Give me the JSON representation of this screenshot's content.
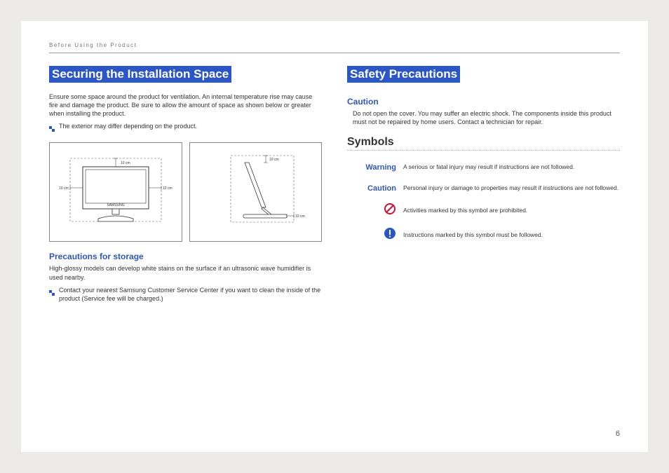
{
  "header": "Before Using the Product",
  "page_number": "6",
  "left": {
    "title": "Securing the Installation Space",
    "intro": "Ensure some space around the product for ventilation. An internal temperature rise may cause fire and damage the product. Be sure to allow the amount of space as shown below or greater when installing the product.",
    "bullet1": "The exterior may differ depending on the product.",
    "dim_top": "10 cm",
    "dim_left": "10 cm",
    "dim_right": "10 cm",
    "dim_side_top": "10 cm",
    "dim_side_bottom": "10 cm",
    "sub_heading": "Precautions for storage",
    "storage_text": "High-glossy models can develop white stains on the surface if an ultrasonic wave humidifier is used nearby.",
    "bullet2": "Contact your nearest Samsung Customer Service Center if you want to clean the inside of the product (Service fee will be charged.)"
  },
  "right": {
    "title": "Safety Precautions",
    "caution_heading": "Caution",
    "caution_text": "Do not open the cover. You may suffer an electric shock. The components inside this product must not be repaired by home users. Contact a technician for repair.",
    "symbols_heading": "Symbols",
    "rows": [
      {
        "label": "Warning",
        "text": "A serious or fatal injury may result if instructions are not followed."
      },
      {
        "label": "Caution",
        "text": "Personal injury or damage to properties may result if instructions are not followed."
      },
      {
        "label": "",
        "text": "Activities marked by this symbol are prohibited."
      },
      {
        "label": "",
        "text": "Instructions marked by this symbol must be followed."
      }
    ]
  }
}
